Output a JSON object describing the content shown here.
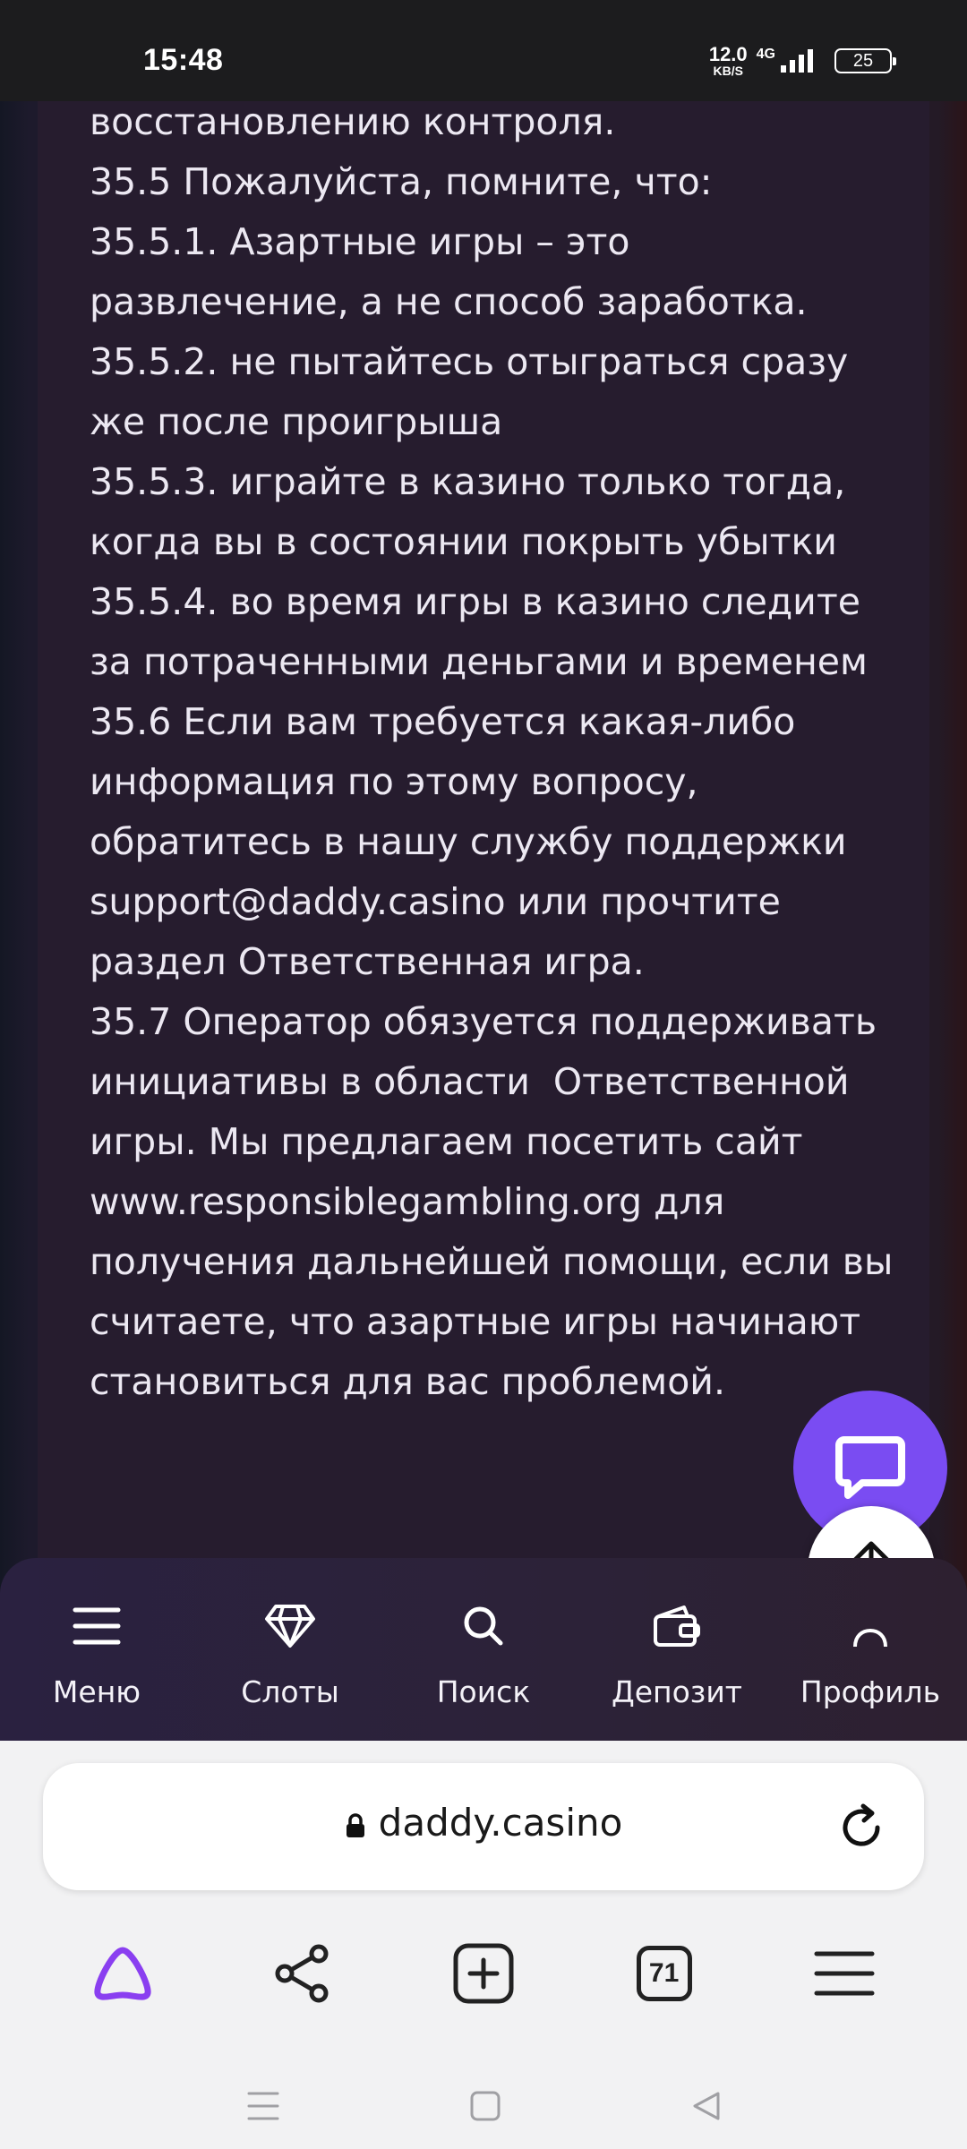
{
  "status_bar": {
    "time": "15:48",
    "net_speed_value": "12.0",
    "net_speed_unit": "KB/S",
    "network_type": "4G",
    "battery": "25"
  },
  "terms": {
    "lines": [
      "восстановлению контроля.",
      "35.5 Пожалуйста, помните, что:",
      "35.5.1. Азартные игры – это развлечение, а не способ заработка.",
      "35.5.2. не пытайтесь отыграться сразу же после проигрыша",
      "35.5.3. играйте в казино только тогда, когда вы в состоянии покрыть убытки",
      "35.5.4. во время игры в казино следите за потраченными деньгами и временем",
      "35.6 Если вам требуется какая-либо информация по этому вопросу, обратитесь в нашу службу поддержки support@daddy.casino или прочтите раздел Ответственная игра.",
      "35.7 Оператор обязуется поддерживать инициативы в области  Ответственной игры. Мы предлагаем посетить сайт www.responsiblegambling.org для получения дальнейшей помощи, если вы считаете, что азартные игры начинают становиться для вас проблемой."
    ]
  },
  "site_nav": {
    "menu": "Меню",
    "slots": "Слоты",
    "search": "Поиск",
    "deposit": "Депозит",
    "profile": "Профиль"
  },
  "browser": {
    "url": "daddy.casino",
    "tabs_count": "71"
  },
  "colors": {
    "accent": "#7a4cf2",
    "page_bg": "#261c2e",
    "nav_bg": "#2a2140"
  }
}
